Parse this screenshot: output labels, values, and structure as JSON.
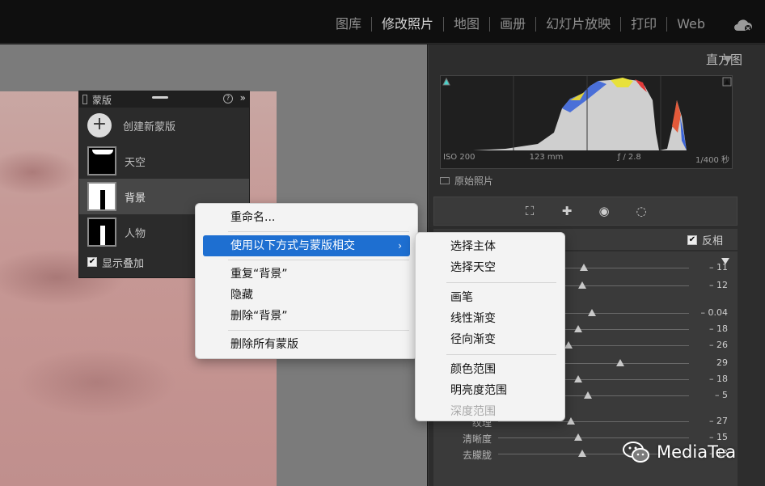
{
  "top_nav": {
    "modules": [
      "图库",
      "修改照片",
      "地图",
      "画册",
      "幻灯片放映",
      "打印",
      "Web"
    ],
    "active": "修改照片",
    "cloud_icon": "cloud-sync-icon"
  },
  "mask_panel": {
    "title": "蒙版",
    "help": "?",
    "more": "»",
    "create_label": "创建新蒙版",
    "masks": [
      {
        "label": "天空",
        "thumb": "sky"
      },
      {
        "label": "背景",
        "thumb": "background"
      },
      {
        "label": "人物",
        "thumb": "person"
      }
    ],
    "selected_mask": "背景",
    "show_overlay_label": "显示叠加",
    "show_overlay_checked": true
  },
  "histogram": {
    "header": "直方图",
    "iso": "ISO 200",
    "focal": "123 mm",
    "aperture": "ƒ / 2.8",
    "shutter": "1/400 秒",
    "original_photo_label": "原始照片"
  },
  "tools": [
    "crop-icon",
    "healing-icon",
    "red-eye-icon",
    "masking-icon"
  ],
  "invert": {
    "label": "反相",
    "checked": true
  },
  "sliders": [
    {
      "label": "",
      "value": "– 11",
      "pos": 0.45
    },
    {
      "label": "",
      "value": "– 12",
      "pos": 0.44
    },
    {
      "label": "",
      "value": "– 0.04",
      "pos": 0.49
    },
    {
      "label": "",
      "value": "– 18",
      "pos": 0.42
    },
    {
      "label": "",
      "value": "– 26",
      "pos": 0.37
    },
    {
      "label": "",
      "value": "29",
      "pos": 0.64
    },
    {
      "label": "",
      "value": "– 18",
      "pos": 0.42
    },
    {
      "label": "",
      "value": "– 5",
      "pos": 0.47
    },
    {
      "label": "纹理",
      "value": "– 27",
      "pos": 0.38
    },
    {
      "label": "清晰度",
      "value": "– 15",
      "pos": 0.42
    },
    {
      "label": "去朦胧",
      "value": "– 13",
      "pos": 0.44
    }
  ],
  "context_menu": {
    "items": [
      "重命名...",
      "使用以下方式与蒙版相交",
      "重复“背景”",
      "隐藏",
      "删除“背景”",
      "删除所有蒙版"
    ],
    "highlighted": "使用以下方式与蒙版相交"
  },
  "submenu": {
    "items": [
      "选择主体",
      "选择天空",
      "画笔",
      "线性渐变",
      "径向渐变",
      "颜色范围",
      "明亮度范围",
      "深度范围"
    ],
    "disabled": [
      "深度范围"
    ]
  },
  "watermark": {
    "text": "MediaTea"
  }
}
